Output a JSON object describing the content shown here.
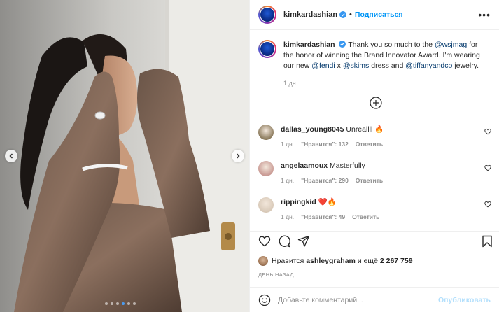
{
  "post": {
    "username": "kimkardashian",
    "follow_label": "Подписаться",
    "more_label": "•••",
    "caption": {
      "username": "kimkardashian",
      "parts": [
        {
          "t": "Thank you so much to the ",
          "m": false
        },
        {
          "t": "@wsjmag",
          "m": true
        },
        {
          "t": " for the honor of winning the Brand Innovator Award. I'm wearing our new ",
          "m": false
        },
        {
          "t": "@fendi",
          "m": true
        },
        {
          "t": " x ",
          "m": false
        },
        {
          "t": "@skims",
          "m": true
        },
        {
          "t": " dress and ",
          "m": false
        },
        {
          "t": "@tiffanyandco",
          "m": true
        },
        {
          "t": " jewelry.",
          "m": false
        }
      ],
      "time": "1 дн."
    }
  },
  "comments": [
    {
      "username": "dallas_young8045",
      "text": "Unreallll 🔥",
      "time": "1 дн.",
      "likes": "\"Нравится\": 132",
      "reply": "Ответить",
      "avatar_color": "#8b7a5c"
    },
    {
      "username": "angelaamoux",
      "text": "Masterfully",
      "time": "1 дн.",
      "likes": "\"Нравится\": 290",
      "reply": "Ответить",
      "avatar_color": "#c99a94"
    },
    {
      "username": "rippingkid",
      "text": "❤️🔥",
      "time": "1 дн.",
      "likes": "\"Нравится\": 49",
      "reply": "Ответить",
      "avatar_color": "#d8c9b8"
    }
  ],
  "likes": {
    "prefix": "Нравится",
    "user": "ashleygraham",
    "middle": "и ещё",
    "count": "2 267 759"
  },
  "posted": "ДЕНЬ НАЗАД",
  "composer": {
    "placeholder": "Добавьте комментарий...",
    "publish_label": "Опубликовать"
  },
  "carousel": {
    "total": 6,
    "active_index": 3
  },
  "colors": {
    "accent": "#0095f6",
    "mention": "#00376b",
    "muted": "#8e8e8e",
    "publish_disabled": "#b2dffc"
  }
}
